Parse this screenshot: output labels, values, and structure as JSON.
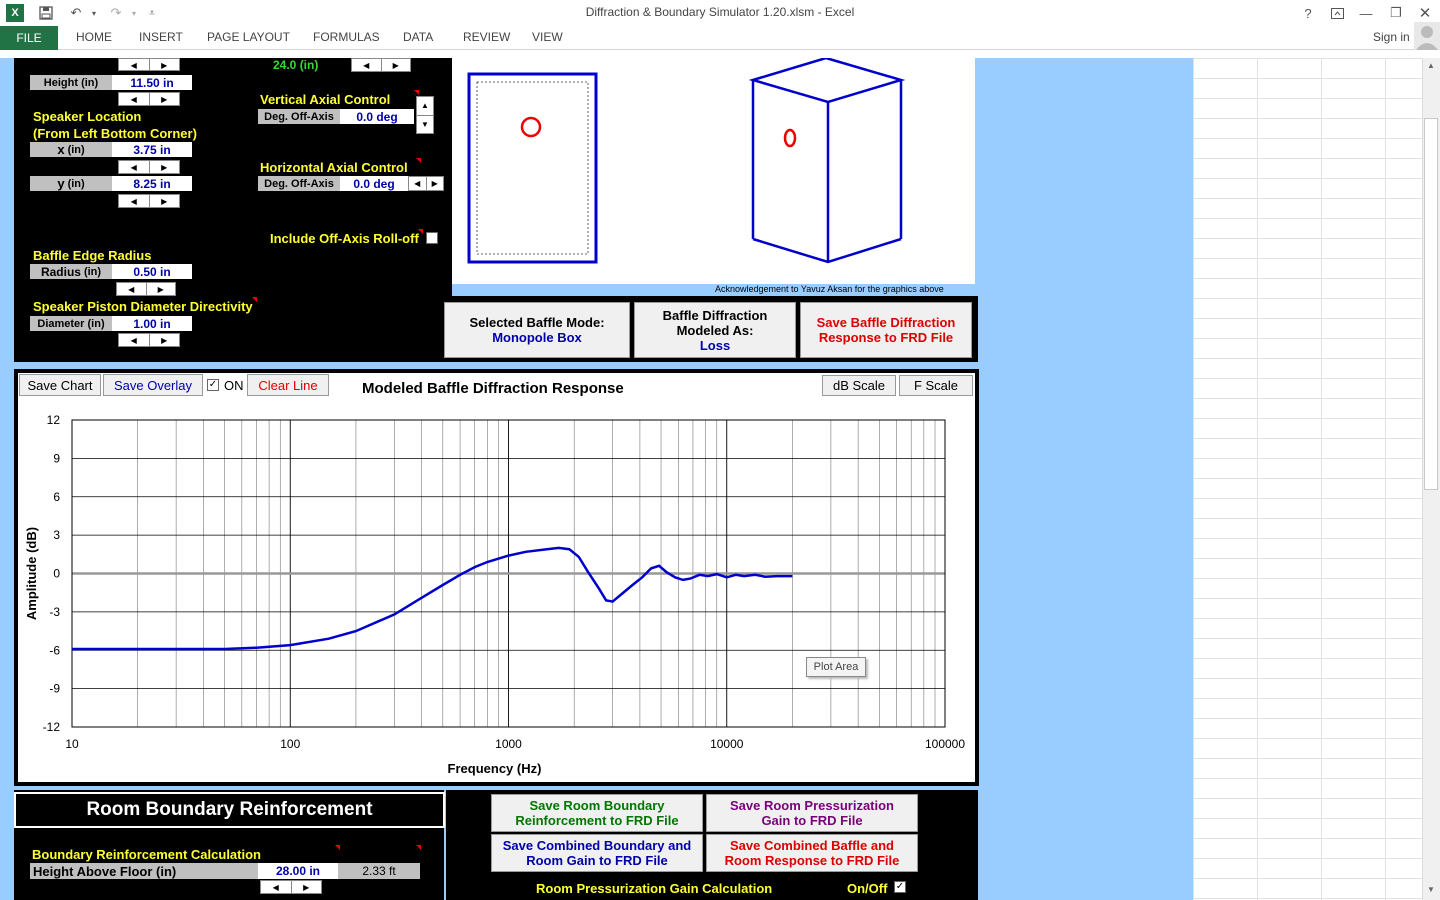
{
  "window": {
    "title": "Diffraction & Boundary Simulator 1.20.xlsm - Excel",
    "help": "?",
    "sign_in": "Sign in"
  },
  "ribbon": {
    "file": "FILE",
    "tabs": [
      "HOME",
      "INSERT",
      "PAGE LAYOUT",
      "FORMULAS",
      "DATA",
      "REVIEW",
      "VIEW"
    ]
  },
  "baffle": {
    "width_value": "24.0 (in)",
    "height_label": "Height (in)",
    "height_value": "11.50 in",
    "speaker_location_title": "Speaker Location",
    "speaker_location_sub": "(From Left Bottom Corner)",
    "x_label": "x",
    "x_unit": "(in)",
    "x_value": "3.75 in",
    "y_label": "y",
    "y_unit": "(in)",
    "y_value": "8.25 in",
    "edge_title": "Baffle Edge Radius",
    "radius_label": "Radius",
    "radius_unit": "(in)",
    "radius_value": "0.50 in",
    "piston_title": "Speaker Piston Diameter Directivity",
    "diameter_label": "Diameter (in)",
    "diameter_value": "1.00 in",
    "vertical_title": "Vertical Axial Control",
    "vertical_label": "Deg. Off-Axis",
    "vertical_value": "0.0 deg",
    "horizontal_title": "Horizontal Axial Control",
    "horizontal_label": "Deg. Off-Axis",
    "horizontal_value": "0.0 deg",
    "rolloff_label": "Include Off-Axis Roll-off"
  },
  "graphics": {
    "credit": "Acknowledgement to Yavuz Aksan for the graphics above"
  },
  "mode_buttons": {
    "selected_mode_label": "Selected Baffle Mode:",
    "selected_mode_value": "Monopole Box",
    "modeled_as_line1": "Baffle Diffraction",
    "modeled_as_line2": "Modeled As:",
    "modeled_as_value": "Loss",
    "save_frd_line1": "Save Baffle Diffraction",
    "save_frd_line2": "Response to FRD File"
  },
  "chart_toolbar": {
    "save_chart": "Save Chart",
    "save_overlay": "Save Overlay",
    "on_label": "ON",
    "clear_line": "Clear Line",
    "db_scale": "dB Scale",
    "f_scale": "F Scale"
  },
  "plot_area_tooltip": "Plot Area",
  "chart_data": {
    "type": "line",
    "title": "Modeled Baffle Diffraction Response",
    "xlabel": "Frequency (Hz)",
    "ylabel": "Amplitude (dB)",
    "xscale": "log",
    "xlim": [
      10,
      100000
    ],
    "ylim": [
      -12,
      12
    ],
    "x_ticks": [
      "10",
      "100",
      "1000",
      "10000",
      "100000"
    ],
    "y_ticks": [
      "12",
      "9",
      "6",
      "3",
      "0",
      "-3",
      "-6",
      "-9",
      "-12"
    ],
    "grid": true,
    "series_color": "#0000cc",
    "series": [
      {
        "x": [
          10,
          30,
          50,
          70,
          100,
          150,
          200,
          300,
          400,
          500,
          600,
          700,
          800,
          1000,
          1200,
          1500,
          1700,
          1900,
          2100,
          2300,
          2600,
          2800,
          3000,
          3300,
          3700,
          4100,
          4500,
          4900,
          5300,
          5800,
          6300,
          6800,
          7500,
          8200,
          9000,
          10000,
          11000,
          12000,
          13500,
          15000,
          17000,
          20000
        ],
        "y": [
          -5.9,
          -5.9,
          -5.9,
          -5.8,
          -5.6,
          -5.1,
          -4.5,
          -3.2,
          -1.9,
          -0.9,
          -0.1,
          0.5,
          0.9,
          1.4,
          1.7,
          1.9,
          2.0,
          1.9,
          1.3,
          0.2,
          -1.2,
          -2.1,
          -2.2,
          -1.6,
          -0.9,
          -0.3,
          0.4,
          0.6,
          0.1,
          -0.3,
          -0.5,
          -0.4,
          -0.1,
          -0.2,
          -0.05,
          -0.3,
          -0.1,
          -0.2,
          -0.1,
          -0.25,
          -0.2,
          -0.2
        ]
      }
    ]
  },
  "room": {
    "title": "Room Boundary Reinforcement",
    "save_boundary_line1": "Save Room Boundary",
    "save_boundary_line2": "Reinforcement to FRD File",
    "save_pressurization_line1": "Save Room Pressurization",
    "save_pressurization_line2": "Gain to FRD File",
    "save_combined_boundary_line1": "Save Combined Boundary and",
    "save_combined_boundary_line2": "Room Gain to FRD File",
    "save_combined_baffle_line1": "Save Combined Baffle and",
    "save_combined_baffle_line2": "Room Response to FRD File",
    "boundary_calc_title": "Boundary Reinforcement Calculation",
    "height_label": "Height Above Floor (in)",
    "height_value": "28.00 in",
    "height_ft": "2.33 ft",
    "pressurization_title": "Room Pressurization Gain Calculation",
    "onoff_label": "On/Off"
  }
}
